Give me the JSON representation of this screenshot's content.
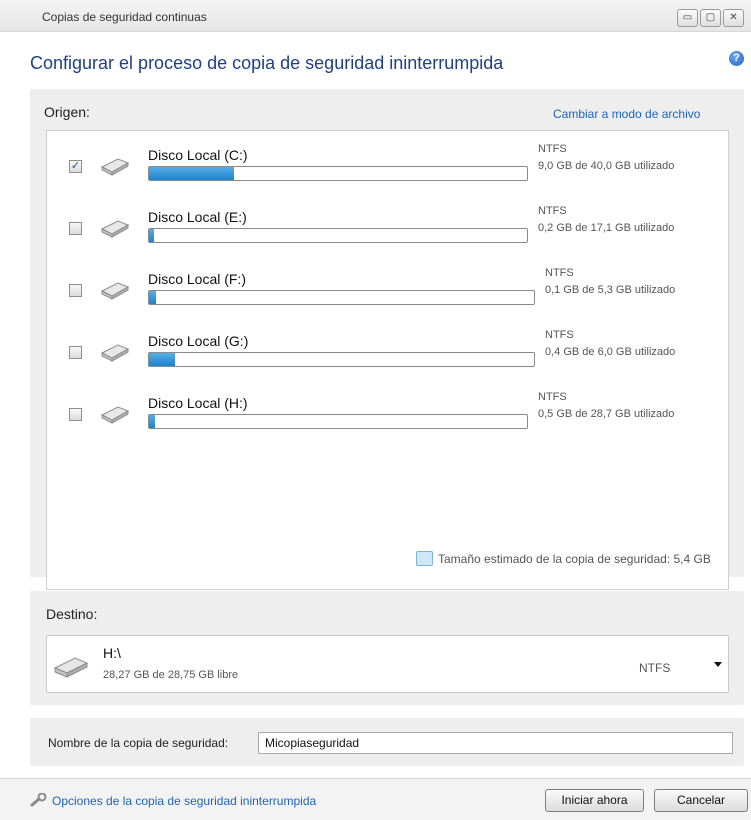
{
  "window": {
    "title": "Copias de seguridad continuas"
  },
  "header": {
    "heading": "Configurar el proceso de copia de seguridad ininterrumpida",
    "help_icon": "help-icon"
  },
  "origin": {
    "label": "Origen:",
    "change_mode_link": "Cambiar a modo de archivo",
    "disks": [
      {
        "name": "Disco Local (C:)",
        "fs": "NTFS",
        "usage": "9,0 GB de 40,0 GB utilizado",
        "checked": true,
        "used_fraction": 0.225
      },
      {
        "name": "Disco Local (E:)",
        "fs": "NTFS",
        "usage": "0,2 GB de 17,1 GB utilizado",
        "checked": false,
        "used_fraction": 0.012
      },
      {
        "name": "Disco Local (F:)",
        "fs": "NTFS",
        "usage": "0,1 GB de 5,3 GB utilizado",
        "checked": false,
        "used_fraction": 0.019
      },
      {
        "name": "Disco Local (G:)",
        "fs": "NTFS",
        "usage": "0,4 GB de 6,0 GB utilizado",
        "checked": false,
        "used_fraction": 0.067
      },
      {
        "name": "Disco Local (H:)",
        "fs": "NTFS",
        "usage": "0,5 GB de 28,7 GB utilizado",
        "checked": false,
        "used_fraction": 0.017
      }
    ],
    "estimate": "Tamaño estimado de la copia de seguridad: 5,4 GB"
  },
  "destination": {
    "label": "Destino:",
    "path": "H:\\",
    "free": "28,27 GB de 28,75 GB libre",
    "fs": "NTFS"
  },
  "backup_name": {
    "label": "Nombre de la copia de seguridad:",
    "value": "Micopiaseguridad"
  },
  "footer": {
    "options_link": "Opciones de la copia de seguridad ininterrumpida",
    "start_button": "Iniciar ahora",
    "cancel_button": "Cancelar"
  },
  "colors": {
    "accent_link": "#1c63c0",
    "heading": "#1f3f8a",
    "bar_fill": "#1c82cf"
  }
}
